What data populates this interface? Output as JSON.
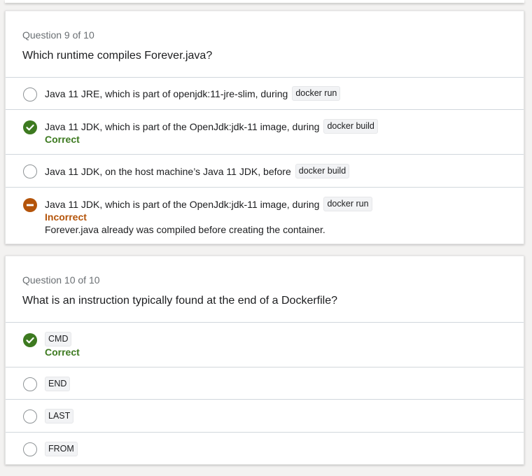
{
  "colors": {
    "correct": "#3d7a20",
    "incorrect": "#b4540a",
    "muted_text": "#6a6f73",
    "divider": "#d1d7dc"
  },
  "questions": [
    {
      "counter": "Question 9 of 10",
      "prompt": "Which runtime compiles Forever.java?",
      "answers": [
        {
          "text": "Java 11 JRE, which is part of openjdk:11-jre-slim, during",
          "code": "docker run",
          "state": "unselected",
          "icon": "radio-empty-icon"
        },
        {
          "text": "Java 11 JDK, which is part of the OpenJdk:jdk-11 image, during",
          "code": "docker build",
          "state": "correct",
          "verdict": "Correct",
          "icon": "check-circle-icon"
        },
        {
          "text": "Java 11 JDK, on the host machine’s Java 11 JDK, before",
          "code": "docker build",
          "state": "unselected",
          "icon": "radio-empty-icon"
        },
        {
          "text": "Java 11 JDK, which is part of the OpenJdk:jdk-11 image, during",
          "code": "docker run",
          "state": "incorrect",
          "verdict": "Incorrect",
          "explanation": "Forever.java already was compiled before creating the container.",
          "icon": "minus-circle-icon"
        }
      ]
    },
    {
      "counter": "Question 10 of 10",
      "prompt": "What is an instruction typically found at the end of a Dockerfile?",
      "answers": [
        {
          "code": "CMD",
          "state": "correct",
          "verdict": "Correct",
          "icon": "check-circle-icon"
        },
        {
          "code": "END",
          "state": "unselected",
          "icon": "radio-empty-icon"
        },
        {
          "code": "LAST",
          "state": "unselected",
          "icon": "radio-empty-icon"
        },
        {
          "code": "FROM",
          "state": "unselected",
          "icon": "radio-empty-icon"
        }
      ]
    }
  ]
}
